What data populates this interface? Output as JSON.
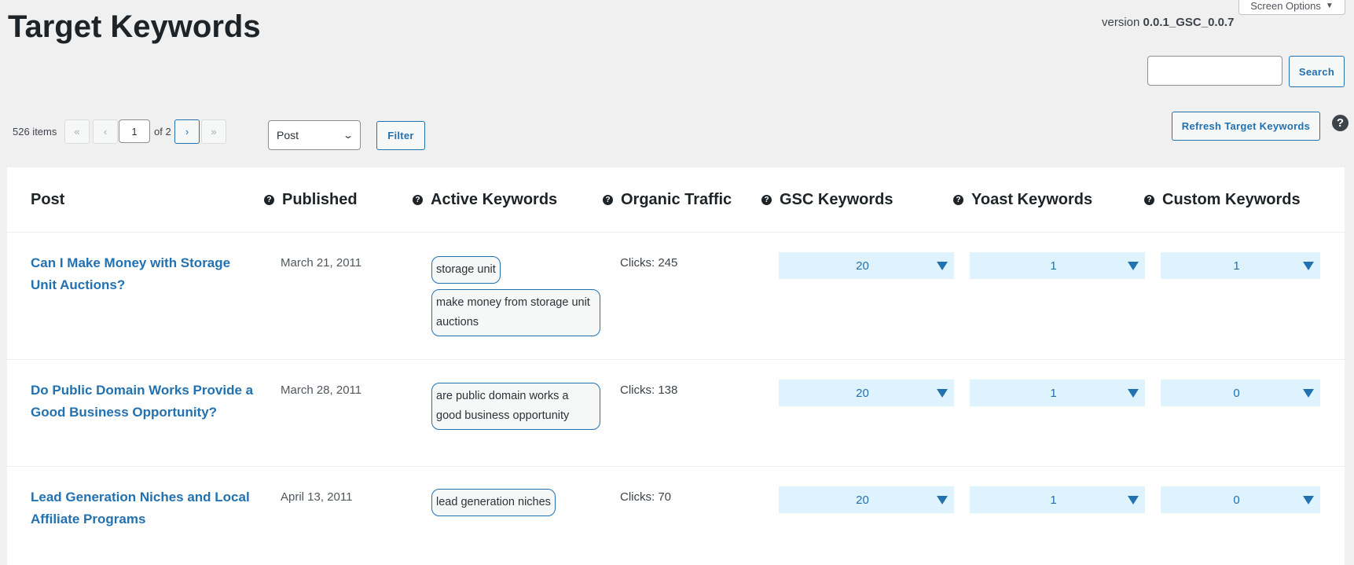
{
  "header": {
    "title": "Target Keywords",
    "screen_options": "Screen Options",
    "version_label": "version",
    "version_value": "0.0.1_GSC_0.0.7"
  },
  "search": {
    "button": "Search",
    "value": ""
  },
  "toolbar": {
    "refresh_button": "Refresh Target Keywords",
    "help_icon": "question-icon",
    "items_count": "526 items",
    "first_page": "«",
    "prev_page": "‹",
    "current_page": "1",
    "of_pages": "of 2",
    "next_page": "›",
    "last_page": "»",
    "post_type_selected": "Post",
    "filter_button": "Filter"
  },
  "table": {
    "columns": {
      "post": "Post",
      "published": "Published",
      "active_keywords": "Active Keywords",
      "organic_traffic": "Organic Traffic",
      "gsc_keywords": "GSC Keywords",
      "yoast_keywords": "Yoast Keywords",
      "custom_keywords": "Custom Keywords"
    },
    "rows": [
      {
        "title": "Can I Make Money with Storage Unit Auctions?",
        "published": "March 21, 2011",
        "keywords": [
          "storage unit",
          "make money from storage unit auctions"
        ],
        "clicks": "Clicks: 245",
        "gsc": "20",
        "yoast": "1",
        "custom": "1"
      },
      {
        "title": "Do Public Domain Works Provide a Good Business Opportunity?",
        "published": "March 28, 2011",
        "keywords": [
          "are public domain works a good business opportunity"
        ],
        "clicks": "Clicks: 138",
        "gsc": "20",
        "yoast": "1",
        "custom": "0"
      },
      {
        "title": "Lead Generation Niches and Local Affiliate Programs",
        "published": "April 13, 2011",
        "keywords": [
          "lead generation niches"
        ],
        "clicks": "Clicks: 70",
        "gsc": "20",
        "yoast": "1",
        "custom": "0"
      }
    ]
  },
  "colors": {
    "accent": "#2271b1",
    "dropdown_bg": "#dff3ff",
    "background": "#f0f0f1"
  }
}
